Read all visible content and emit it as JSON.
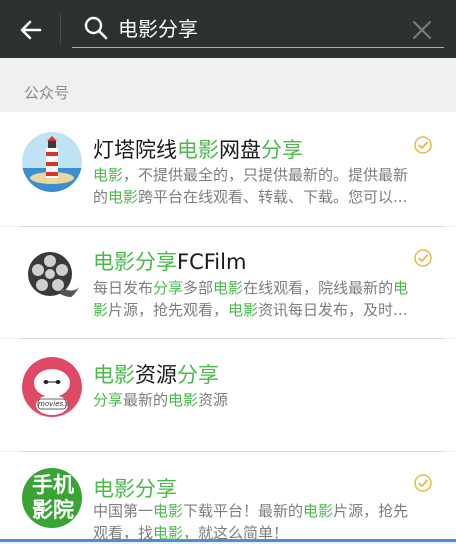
{
  "search": {
    "query": "电影分享"
  },
  "section": {
    "label": "公众号"
  },
  "results": [
    {
      "name_parts": [
        "灯塔院线",
        "电影",
        "网盘",
        "分享"
      ],
      "desc_line1_parts": [
        "电影",
        "，不提供最全的，只提供最新的。提供最新"
      ],
      "desc_line2_parts": [
        "的",
        "电影",
        "跨平台在线观看、转载、下载。您可以..."
      ],
      "verified": true,
      "avatar": "lighthouse-avatar"
    },
    {
      "name_parts": [
        "电影分享",
        "FCFilm"
      ],
      "desc_line1_parts": [
        "每日发布",
        "分享",
        "多部",
        "电影",
        "在线观看，院线最新的",
        "电"
      ],
      "desc_line2_parts": [
        "影",
        "片源，抢先观看，",
        "电影",
        "资讯每日发布，及时..."
      ],
      "verified": true,
      "avatar": "film-reel-avatar"
    },
    {
      "name_parts": [
        "电影",
        "资源",
        "分享"
      ],
      "desc_line1_parts": [
        "分享",
        "最新的",
        "电影",
        "资源"
      ],
      "verified": false,
      "avatar": "robot-avatar",
      "avatar_text": "movies.s"
    },
    {
      "name_parts": [
        "电影分享"
      ],
      "desc_line1_parts": [
        "中国第一",
        "电影",
        "下载平台！最新的",
        "电影",
        "片源，抢先"
      ],
      "desc_line2_parts": [
        "观看，找",
        "电影",
        "，就这么简单！"
      ],
      "verified": true,
      "avatar": "phone-cinema-avatar",
      "avatar_text": "手机影院"
    }
  ],
  "colors": {
    "highlight": "#4bb94b",
    "topbar": "#2e3132",
    "check": "#e6b84a"
  }
}
